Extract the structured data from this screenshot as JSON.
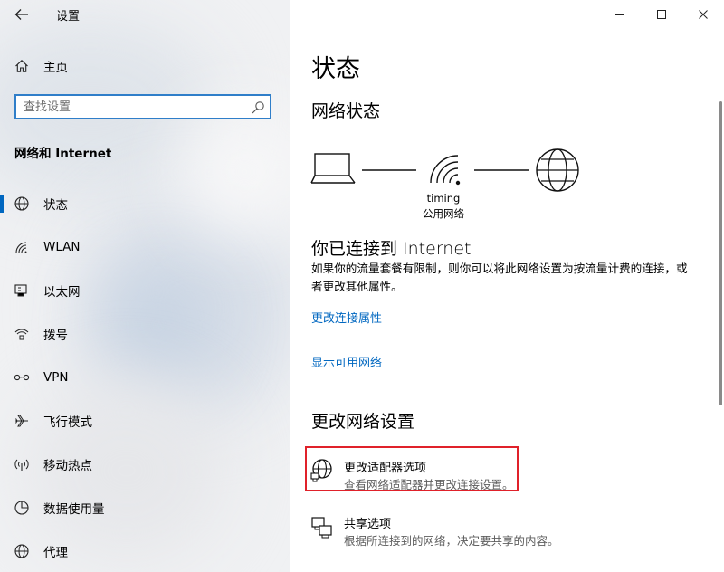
{
  "window": {
    "title": "设置",
    "controls": [
      "minimize-icon",
      "maximize-icon",
      "close-icon"
    ]
  },
  "sidebar": {
    "home_label": "主页",
    "search_placeholder": "查找设置",
    "category_title": "网络和 Internet",
    "items": [
      {
        "label": "状态",
        "icon": "globe-status-icon",
        "selected": true
      },
      {
        "label": "WLAN",
        "icon": "wifi-icon",
        "selected": false
      },
      {
        "label": "以太网",
        "icon": "ethernet-icon",
        "selected": false
      },
      {
        "label": "拨号",
        "icon": "dialup-icon",
        "selected": false
      },
      {
        "label": "VPN",
        "icon": "vpn-icon",
        "selected": false
      },
      {
        "label": "飞行模式",
        "icon": "airplane-icon",
        "selected": false
      },
      {
        "label": "移动热点",
        "icon": "hotspot-icon",
        "selected": false
      },
      {
        "label": "数据使用量",
        "icon": "data-usage-icon",
        "selected": false
      },
      {
        "label": "代理",
        "icon": "proxy-globe-icon",
        "selected": false
      }
    ]
  },
  "main": {
    "page_title": "状态",
    "network_status": {
      "heading": "网络状态",
      "network_name": "timing",
      "network_type": "公用网络"
    },
    "connected": {
      "heading": "你已连接到 Internet",
      "description": "如果你的流量套餐有限制，则你可以将此网络设置为按流量计费的连接，或者更改其他属性。",
      "links": [
        "更改连接属性",
        "显示可用网络"
      ]
    },
    "change_settings": {
      "heading": "更改网络设置",
      "options": [
        {
          "title": "更改适配器选项",
          "desc": "查看网络适配器并更改连接设置。",
          "icon": "adapter-globe-icon",
          "highlighted": true
        },
        {
          "title": "共享选项",
          "desc": "根据所连接到的网络，决定要共享的内容。",
          "icon": "sharing-icon",
          "highlighted": false
        }
      ]
    }
  },
  "colors": {
    "accent": "#0067c0",
    "highlight_box": "#e0212a",
    "sidebar_bg": "#f0f1f3",
    "search_border": "#2f7ec9"
  }
}
